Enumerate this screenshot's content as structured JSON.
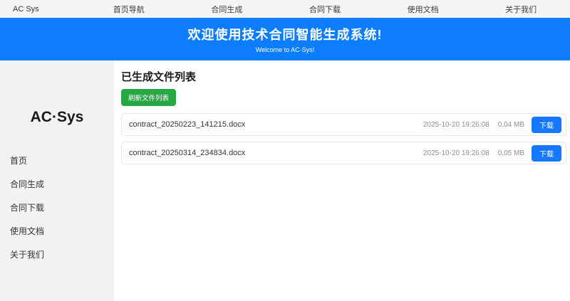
{
  "navbar": {
    "brand": "AC Sys",
    "items": [
      "首页导航",
      "合同生成",
      "合同下载",
      "使用文档",
      "关于我们"
    ]
  },
  "banner": {
    "title": "欢迎使用技术合同智能生成系统!",
    "subtitle": "Welcome to AC·Sys!"
  },
  "sidebar": {
    "logo": "AC·Sys",
    "items": [
      "首页",
      "合同生成",
      "合同下载",
      "使用文档",
      "关于我们"
    ]
  },
  "main": {
    "heading": "已生成文件列表",
    "refresh_label": "刷新文件列表",
    "files": [
      {
        "name": "contract_20250223_141215.docx",
        "timestamp": "2025-10-20 19:26:08",
        "size": "0.04 MB",
        "download_label": "下载"
      },
      {
        "name": "contract_20250314_234834.docx",
        "timestamp": "2025-10-20 19:26:08",
        "size": "0.05 MB",
        "download_label": "下载"
      }
    ]
  },
  "colors": {
    "primary_blue": "#0d7dfc",
    "button_blue": "#1677ff",
    "success_green": "#28a745",
    "navbar_bg": "#f5f5f5",
    "sidebar_bg": "#f2f2f2"
  }
}
